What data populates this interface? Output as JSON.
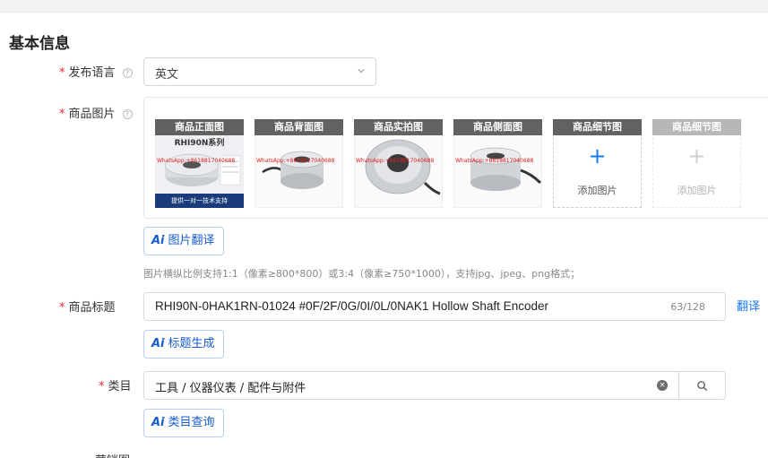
{
  "section": {
    "title": "基本信息"
  },
  "language": {
    "label": "发布语言",
    "value": "英文"
  },
  "images": {
    "label": "商品图片",
    "slots": [
      {
        "caption": "商品正面图",
        "subtitle": "RHI90N系列",
        "watermark": "WhatsApp:+8618817040688",
        "band": "提供一对一技术支持"
      },
      {
        "caption": "商品背面图",
        "watermark": "WhatsApp:+8618817040688"
      },
      {
        "caption": "商品实拍图",
        "watermark": "WhatsApp:+8618817040688"
      },
      {
        "caption": "商品侧面图",
        "watermark": "WhatsApp:+8618817040688"
      },
      {
        "caption": "商品细节图",
        "add_text": "添加图片",
        "plus": "+"
      },
      {
        "caption": "商品细节图",
        "add_text": "添加图片",
        "plus": "+"
      }
    ],
    "translate_btn": "图片翻译",
    "hint": "图片横纵比例支持1:1（像素≥800*800）或3:4（像素≥750*1000），支持jpg、jpeg、png格式；"
  },
  "title": {
    "label": "商品标题",
    "value": "RHI90N-0HAK1RN-01024 #0F/2F/0G/0I/0L/0NAK1 Hollow Shaft Encoder",
    "count": "63/128",
    "translate_link": "翻译",
    "generate_btn": "标题生成"
  },
  "category": {
    "label": "类目",
    "value": "工具 / 仪器仪表 / 配件与附件",
    "query_btn": "类目查询"
  },
  "ai_mark": "Ai",
  "required_mark": "*",
  "help_mark": "?",
  "next_label": "营销图",
  "colors": {
    "accent": "#1677ff",
    "required": "#f5222d",
    "ai": "#1a5bcc"
  }
}
